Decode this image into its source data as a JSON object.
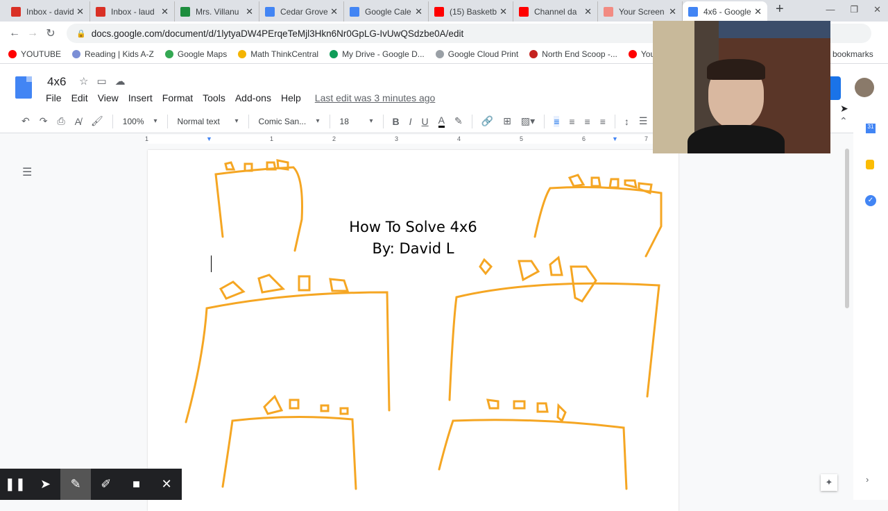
{
  "tabs": [
    {
      "label": "Inbox - david",
      "icon": "gmail-icon",
      "color": "#d93025"
    },
    {
      "label": "Inbox - laud",
      "icon": "gmail-icon",
      "color": "#d93025"
    },
    {
      "label": "Mrs. Villanu",
      "icon": "classroom-icon",
      "color": "#1e8e3e"
    },
    {
      "label": "Cedar Grove",
      "icon": "calendar-icon",
      "color": "#4285f4"
    },
    {
      "label": "Google Cale",
      "icon": "calendar-icon",
      "color": "#4285f4"
    },
    {
      "label": "(15) Basketb",
      "icon": "youtube-icon",
      "color": "#ff0000"
    },
    {
      "label": "Channel da",
      "icon": "youtube-icon",
      "color": "#ff0000"
    },
    {
      "label": "Your Screen",
      "icon": "screencastify-icon",
      "color": "#f28b82"
    },
    {
      "label": "4x6 - Google",
      "icon": "docs-icon",
      "color": "#4285f4"
    }
  ],
  "url": "docs.google.com/document/d/1lytyaDW4PErqeTeMjl3Hkn6Nr0GpLG-IvUwQSdzbe0A/edit",
  "bookmarks": [
    {
      "label": "YOUTUBE",
      "color": "#ff0000"
    },
    {
      "label": "Reading | Kids A-Z",
      "color": "#7b8fd6"
    },
    {
      "label": "Google Maps",
      "color": "#34a853"
    },
    {
      "label": "Math ThinkCentral",
      "color": "#f4b400"
    },
    {
      "label": "My Drive - Google D...",
      "color": "#0f9d58"
    },
    {
      "label": "Google Cloud Print",
      "color": "#9aa0a6"
    },
    {
      "label": "North End Scoop -...",
      "color": "#c5221f"
    },
    {
      "label": "YouTu",
      "color": "#ff0000"
    }
  ],
  "other_bookmarks": "bookmarks",
  "doc": {
    "title": "4x6",
    "menus": [
      "File",
      "Edit",
      "View",
      "Insert",
      "Format",
      "Tools",
      "Add-ons",
      "Help"
    ],
    "last_edit": "Last edit was 3 minutes ago"
  },
  "toolbar": {
    "zoom": "100%",
    "style": "Normal text",
    "font": "Comic San...",
    "size": "18"
  },
  "ruler": [
    "1",
    "1",
    "2",
    "3",
    "4",
    "5",
    "6",
    "7"
  ],
  "content": {
    "line1": "How To Solve 4x6",
    "line2": "By: David L"
  },
  "drawing_color": "#f5a623"
}
